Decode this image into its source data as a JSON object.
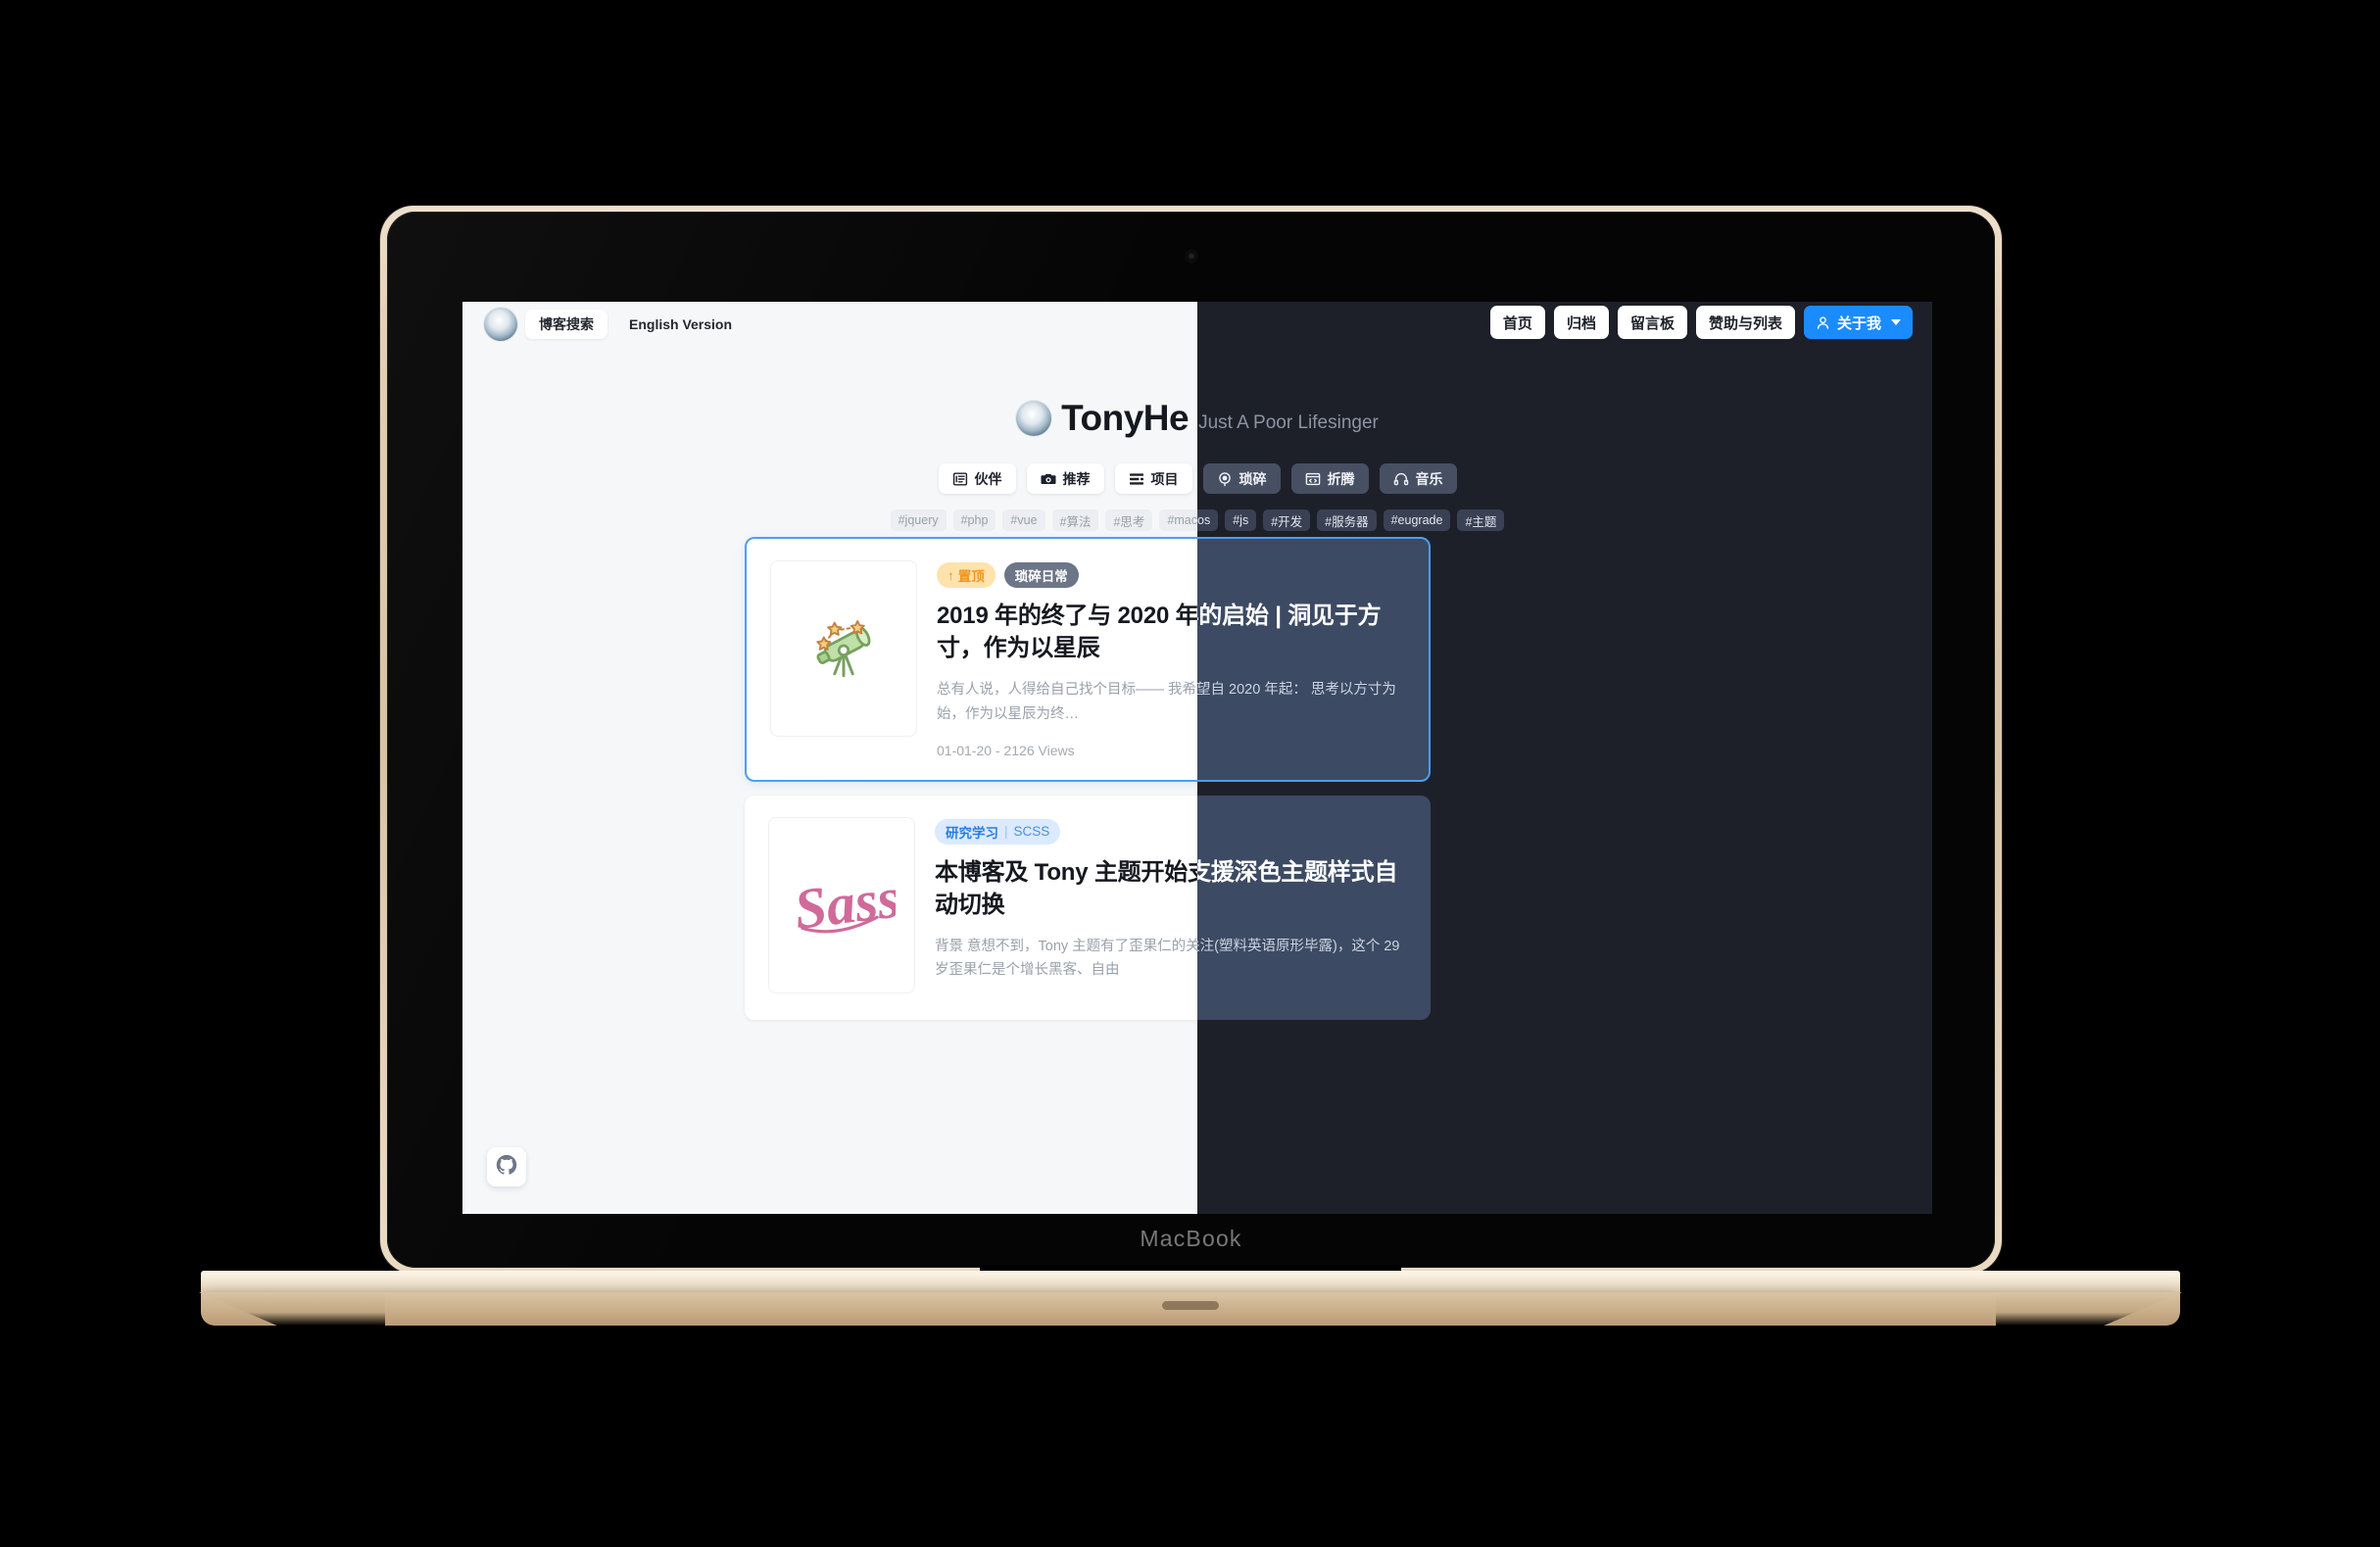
{
  "device": {
    "wordmark": "MacBook"
  },
  "topbar": {
    "search_label": "博客搜索",
    "english_label": "English Version",
    "nav": [
      {
        "label": "首页",
        "name": "nav-home"
      },
      {
        "label": "归档",
        "name": "nav-archive"
      },
      {
        "label": "留言板",
        "name": "nav-guestbook"
      },
      {
        "label": "赞助与列表",
        "name": "nav-sponsor"
      }
    ],
    "about_label": "关于我"
  },
  "hero": {
    "name": "TonyHe",
    "tagline": "Just A Poor Lifesinger",
    "categories": [
      {
        "label": "伙伴",
        "icon": "list-icon"
      },
      {
        "label": "推荐",
        "icon": "camera-icon"
      },
      {
        "label": "项目",
        "icon": "stack-icon"
      },
      {
        "label": "琐碎",
        "icon": "record-icon"
      },
      {
        "label": "折腾",
        "icon": "code-window-icon"
      },
      {
        "label": "音乐",
        "icon": "headphone-icon"
      }
    ],
    "tags": [
      "#jquery",
      "#php",
      "#vue",
      "#算法",
      "#思考",
      "#macos",
      "#js",
      "#开发",
      "#服务器",
      "#eugrade",
      "#主题"
    ]
  },
  "posts": [
    {
      "featured": true,
      "pin_label": "置顶",
      "category": "琐碎日常",
      "category_style": "dark",
      "title": "2019 年的终了与 2020 年的启始 | 洞见于方寸，作为以星辰",
      "excerpt": "总有人说，人得给自己找个目标—— 我希望自 2020 年起： 思考以方寸为始，作为以星辰为终…",
      "date": "01-01-20",
      "views": "2126 Views",
      "meta": "01-01-20 - 2126 Views",
      "thumb": "telescope-emoji"
    },
    {
      "featured": false,
      "pin_label": "",
      "category": "研究学习",
      "category_sub": "SCSS",
      "category_style": "blue",
      "title": "本博客及 Tony 主题开始支援深色主题样式自动切换",
      "excerpt": "背景 意想不到，Tony 主题有了歪果仁的关注(塑料英语原形毕露)，这个 29 岁歪果仁是个增长黑客、自由",
      "date": "",
      "views": "",
      "meta": "",
      "thumb": "sass-logo"
    }
  ],
  "floating": {
    "github_label": "github-icon"
  },
  "colors": {
    "accent_blue": "#1a8cff",
    "featured_border": "#4a9ef5",
    "dark_bg": "#1e2029",
    "dark_card": "#3c4a63",
    "pin_badge_bg": "#ffe2ac",
    "pin_badge_fg": "#f0941f",
    "light_bg": "#f6f7f9"
  }
}
